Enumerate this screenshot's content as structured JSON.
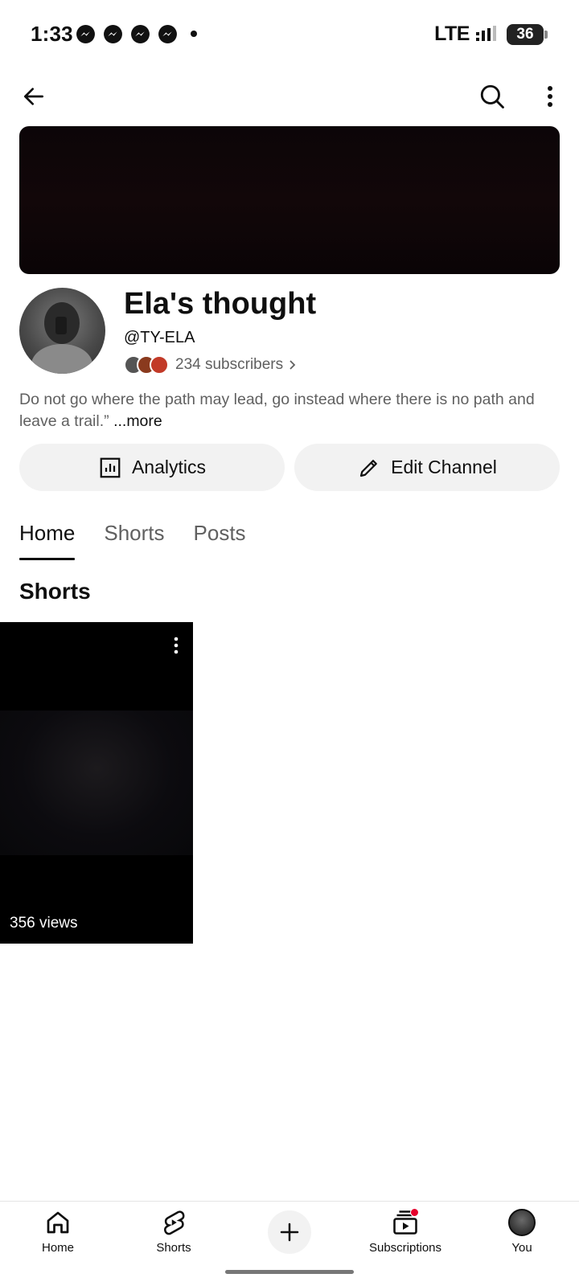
{
  "status_bar": {
    "time": "1:33",
    "network": "LTE",
    "battery": "36",
    "notification_icons": [
      "messenger-icon",
      "messenger-icon",
      "messenger-icon",
      "messenger-icon"
    ]
  },
  "channel": {
    "name": "Ela's thought",
    "handle": "@TY-ELA",
    "subscribers": "234 subscribers",
    "description": "Do not go where the path may lead, go instead where there is no path and leave a trail.”",
    "more_label": "...more"
  },
  "actions": {
    "analytics_label": "Analytics",
    "edit_label": "Edit Channel"
  },
  "tabs": [
    {
      "label": "Home",
      "active": true
    },
    {
      "label": "Shorts",
      "active": false
    },
    {
      "label": "Posts",
      "active": false
    }
  ],
  "section": {
    "title": "Shorts"
  },
  "shorts": [
    {
      "views": "356 views"
    }
  ],
  "bottom_nav": {
    "home": "Home",
    "shorts": "Shorts",
    "subscriptions": "Subscriptions",
    "you": "You"
  },
  "colors": {
    "accent_red": "#e5002b",
    "secondary_text": "#606060",
    "button_bg": "#f2f2f2"
  }
}
